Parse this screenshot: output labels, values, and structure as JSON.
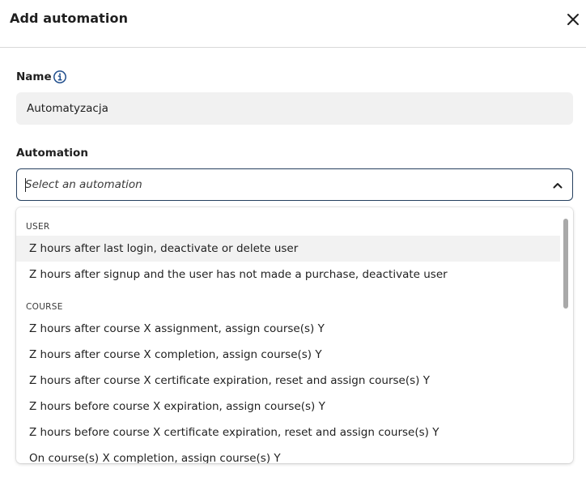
{
  "dialog": {
    "title": "Add automation",
    "close_icon": "close-icon"
  },
  "name_field": {
    "label": "Name",
    "info_icon": "info-icon",
    "value": "Automatyzacja"
  },
  "automation_field": {
    "label": "Automation",
    "placeholder": "Select an automation",
    "chevron_icon": "chevron-up-icon",
    "open": true
  },
  "dropdown": {
    "groups": [
      {
        "label": "USER",
        "options": [
          "Z hours after last login, deactivate or delete user",
          "Z hours after signup and the user has not made a purchase, deactivate user"
        ]
      },
      {
        "label": "COURSE",
        "options": [
          "Z hours after course X assignment, assign course(s) Y",
          "Z hours after course X completion, assign course(s) Y",
          "Z hours after course X certificate expiration, reset and assign course(s) Y",
          "Z hours before course X expiration, assign course(s) Y",
          "Z hours before course X certificate expiration, reset and assign course(s) Y",
          "On course(s) X completion, assign course(s) Y"
        ]
      }
    ],
    "highlighted_option": "Z hours after last login, deactivate or delete user"
  },
  "colors": {
    "focus_border": "#26405f",
    "info_icon": "#1f4d8c",
    "highlight_bg": "#f2f2f2",
    "input_bg": "#f1f1f1"
  }
}
